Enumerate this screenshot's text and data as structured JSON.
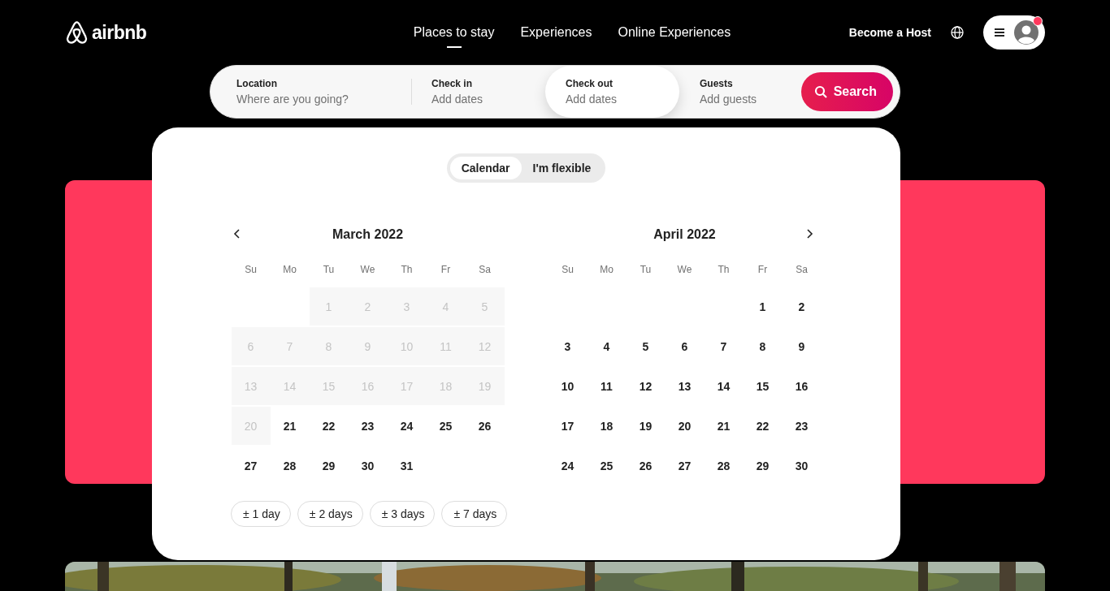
{
  "header": {
    "logo": "airbnb",
    "nav": [
      {
        "label": "Places to stay",
        "selected": true
      },
      {
        "label": "Experiences",
        "selected": false
      },
      {
        "label": "Online Experiences",
        "selected": false
      }
    ],
    "host_link": "Become a Host",
    "notification": true
  },
  "search": {
    "fields": [
      {
        "label": "Location",
        "placeholder": "Where are you going?",
        "selected": false
      },
      {
        "label": "Check in",
        "placeholder": "Add dates",
        "selected": false
      },
      {
        "label": "Check out",
        "placeholder": "Add dates",
        "selected": true
      },
      {
        "label": "Guests",
        "placeholder": "Add guests",
        "selected": false
      }
    ],
    "button": "Search"
  },
  "date_picker": {
    "tabs": [
      {
        "label": "Calendar",
        "selected": true
      },
      {
        "label": "I'm flexible",
        "selected": false
      }
    ],
    "months": [
      {
        "title": "March 2022",
        "weekdays": [
          "Su",
          "Mo",
          "Tu",
          "We",
          "Th",
          "Fr",
          "Sa"
        ],
        "weeks": [
          {
            "kind": "leading",
            "days": [
              {
                "d": "1",
                "disabled": true
              },
              {
                "d": "2",
                "disabled": true
              },
              {
                "d": "3",
                "disabled": true
              },
              {
                "d": "4",
                "disabled": true
              },
              {
                "d": "5",
                "disabled": true
              }
            ]
          },
          {
            "kind": "full",
            "days": [
              {
                "d": "6",
                "disabled": true
              },
              {
                "d": "7",
                "disabled": true
              },
              {
                "d": "8",
                "disabled": true
              },
              {
                "d": "9",
                "disabled": true
              },
              {
                "d": "10",
                "disabled": true
              },
              {
                "d": "11",
                "disabled": true
              },
              {
                "d": "12",
                "disabled": true
              }
            ]
          },
          {
            "kind": "full",
            "days": [
              {
                "d": "13",
                "disabled": true
              },
              {
                "d": "14",
                "disabled": true
              },
              {
                "d": "15",
                "disabled": true
              },
              {
                "d": "16",
                "disabled": true
              },
              {
                "d": "17",
                "disabled": true
              },
              {
                "d": "18",
                "disabled": true
              },
              {
                "d": "19",
                "disabled": true
              }
            ]
          },
          {
            "kind": "full",
            "days": [
              {
                "d": "20",
                "disabled": true
              },
              {
                "d": "21",
                "disabled": false
              },
              {
                "d": "22",
                "disabled": false
              },
              {
                "d": "23",
                "disabled": false
              },
              {
                "d": "24",
                "disabled": false
              },
              {
                "d": "25",
                "disabled": false
              },
              {
                "d": "26",
                "disabled": false
              }
            ]
          },
          {
            "kind": "trailing",
            "days": [
              {
                "d": "27",
                "disabled": false
              },
              {
                "d": "28",
                "disabled": false
              },
              {
                "d": "29",
                "disabled": false
              },
              {
                "d": "30",
                "disabled": false
              },
              {
                "d": "31",
                "disabled": false
              }
            ]
          }
        ]
      },
      {
        "title": "April 2022",
        "weekdays": [
          "Su",
          "Mo",
          "Tu",
          "We",
          "Th",
          "Fr",
          "Sa"
        ],
        "weeks": [
          {
            "kind": "leading",
            "days": [
              {
                "d": "1",
                "disabled": false
              },
              {
                "d": "2",
                "disabled": false
              }
            ]
          },
          {
            "kind": "full",
            "days": [
              {
                "d": "3",
                "disabled": false
              },
              {
                "d": "4",
                "disabled": false
              },
              {
                "d": "5",
                "disabled": false
              },
              {
                "d": "6",
                "disabled": false
              },
              {
                "d": "7",
                "disabled": false
              },
              {
                "d": "8",
                "disabled": false
              },
              {
                "d": "9",
                "disabled": false
              }
            ]
          },
          {
            "kind": "full",
            "days": [
              {
                "d": "10",
                "disabled": false
              },
              {
                "d": "11",
                "disabled": false
              },
              {
                "d": "12",
                "disabled": false
              },
              {
                "d": "13",
                "disabled": false
              },
              {
                "d": "14",
                "disabled": false
              },
              {
                "d": "15",
                "disabled": false
              },
              {
                "d": "16",
                "disabled": false
              }
            ]
          },
          {
            "kind": "full",
            "days": [
              {
                "d": "17",
                "disabled": false
              },
              {
                "d": "18",
                "disabled": false
              },
              {
                "d": "19",
                "disabled": false
              },
              {
                "d": "20",
                "disabled": false
              },
              {
                "d": "21",
                "disabled": false
              },
              {
                "d": "22",
                "disabled": false
              },
              {
                "d": "23",
                "disabled": false
              }
            ]
          },
          {
            "kind": "full",
            "days": [
              {
                "d": "24",
                "disabled": false
              },
              {
                "d": "25",
                "disabled": false
              },
              {
                "d": "26",
                "disabled": false
              },
              {
                "d": "27",
                "disabled": false
              },
              {
                "d": "28",
                "disabled": false
              },
              {
                "d": "29",
                "disabled": false
              },
              {
                "d": "30",
                "disabled": false
              }
            ]
          }
        ]
      }
    ],
    "flex_options": [
      "± 1 day",
      "± 2 days",
      "± 3 days",
      "± 7 days"
    ]
  }
}
